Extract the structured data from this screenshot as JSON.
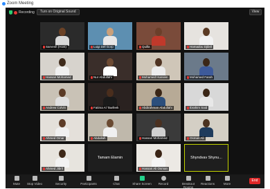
{
  "window": {
    "title": "Zoom Meeting"
  },
  "topbar": {
    "recording_label": "Recording",
    "cc_button": "Turn on Original Sound",
    "view_button": "View"
  },
  "tiles": [
    {
      "name": "Sarvesh (Host)",
      "muted": true,
      "bg": "#2b2b2b",
      "skin": "#6b4226",
      "shirt": "#d9d9d9"
    },
    {
      "name": "Luigi Del Gorp",
      "muted": true,
      "bg": "#5d8fb1",
      "skin": "#caa07a",
      "shirt": "#e8e8e8"
    },
    {
      "name": "Quilla",
      "muted": true,
      "bg": "#7a4b3a",
      "skin": "#6b3f2a",
      "shirt": "#c0392b"
    },
    {
      "name": "Hamadou Djibril",
      "muted": true,
      "bg": "#e6e3df",
      "skin": "#5a3a24",
      "shirt": "#f2f2f2"
    },
    {
      "name": "Hassan Mohamed",
      "muted": true,
      "bg": "#d7d3cd",
      "skin": "#3e2a1b",
      "shirt": "#f0f0f0"
    },
    {
      "name": "Nur Abdullahi",
      "muted": true,
      "bg": "#3a2e2a",
      "skin": "#6d4a33",
      "shirt": "#ffffff"
    },
    {
      "name": "Mohamed Hussein",
      "muted": true,
      "bg": "#cfc6b8",
      "skin": "#4e3322",
      "shirt": "#ececec"
    },
    {
      "name": "Mohamed Farah",
      "muted": true,
      "bg": "#6b7a8a",
      "skin": "#3b2718",
      "shirt": "#3d5a9a"
    },
    {
      "name": "Andrew Colvin",
      "muted": true,
      "bg": "#c9c2b6",
      "skin": "#5b3b26",
      "shirt": "#e0e0e0"
    },
    {
      "name": "Fatima Al Tawfeek",
      "muted": true,
      "bg": "#2a2220",
      "skin": "#4a2e1d",
      "shirt": "#1a1a1a"
    },
    {
      "name": "Abdirahman Abdullahi",
      "muted": true,
      "bg": "#b7aa96",
      "skin": "#3a2616",
      "shirt": "#2c4f7c"
    },
    {
      "name": "Ibrahim Said",
      "muted": true,
      "bg": "#d8d8d8",
      "skin": "#3a2616",
      "shirt": "#e8e8e8"
    },
    {
      "name": "Ahmed Omar",
      "muted": true,
      "bg": "#e4e0da",
      "skin": "#5d3c27",
      "shirt": "#f0f0f0"
    },
    {
      "name": "Abdullah",
      "muted": true,
      "bg": "#bfb8ab",
      "skin": "#6a4a32",
      "shirt": "#f0f0f0"
    },
    {
      "name": "Hassan Mohamed",
      "muted": true,
      "bg": "#3a3a3a",
      "skin": "#4a3020",
      "shirt": "#d0d0d0"
    },
    {
      "name": "Osman Ali",
      "muted": true,
      "bg": "#d4cfc5",
      "skin": "#4b3220",
      "shirt": "#1f3b5c"
    },
    {
      "name": "Ahmed Jibril",
      "muted": true,
      "bg": "#e7e4de",
      "skin": "#3d2818",
      "shirt": "#f2f2f2"
    },
    {
      "name": "Hassan Ali Osman",
      "muted": true,
      "bg": "#ece9e4",
      "skin": "#3a2415",
      "shirt": "#f4f4f4"
    },
    {
      "name": "Mohamed Ali",
      "muted": true,
      "bg": "#d9d5ce",
      "skin": "#5a3a25",
      "shirt": "#e6e6e6"
    },
    {
      "name": "Osman Sheikh",
      "muted": true,
      "bg": "#d2cbbf",
      "skin": "#3a2517",
      "shirt": "#1e1e1e"
    }
  ],
  "name_tiles": [
    {
      "name": "Tamam Elamin"
    },
    {
      "name": "Shyndvav Shynu..."
    }
  ],
  "last_row": [
    {
      "name": "Omar Jama",
      "muted": true,
      "bg": "#bdb5a8",
      "skin": "#3a2616",
      "shirt": "#f2f2f2"
    },
    {
      "name": "Omar Mohamed",
      "muted": true,
      "bg": "#ecebe7",
      "skin": "#3e2818",
      "shirt": "#111111"
    }
  ],
  "toolbar": {
    "items": [
      "Mute",
      "Stop Video",
      "Security",
      "Participants",
      "Chat",
      "Share Screen",
      "Record",
      "Breakout Rooms",
      "Reactions",
      "More"
    ],
    "end_label": "End",
    "participants_count": "26"
  },
  "colors": {
    "share_green": "#23d18b",
    "end_red": "#e02828",
    "active_border": "#c4d400"
  }
}
